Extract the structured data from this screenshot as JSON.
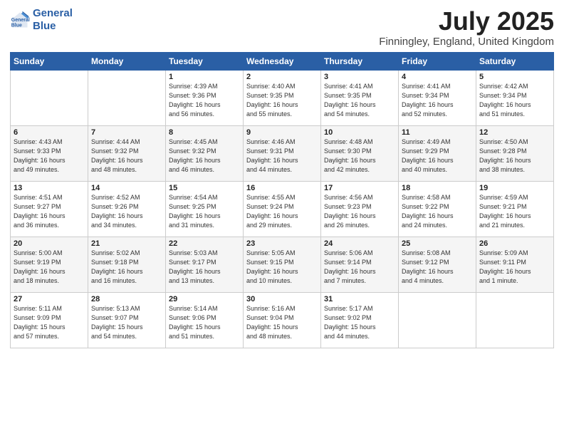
{
  "header": {
    "logo_line1": "General",
    "logo_line2": "Blue",
    "month": "July 2025",
    "location": "Finningley, England, United Kingdom"
  },
  "weekdays": [
    "Sunday",
    "Monday",
    "Tuesday",
    "Wednesday",
    "Thursday",
    "Friday",
    "Saturday"
  ],
  "weeks": [
    [
      {
        "day": "",
        "info": ""
      },
      {
        "day": "",
        "info": ""
      },
      {
        "day": "1",
        "info": "Sunrise: 4:39 AM\nSunset: 9:36 PM\nDaylight: 16 hours\nand 56 minutes."
      },
      {
        "day": "2",
        "info": "Sunrise: 4:40 AM\nSunset: 9:35 PM\nDaylight: 16 hours\nand 55 minutes."
      },
      {
        "day": "3",
        "info": "Sunrise: 4:41 AM\nSunset: 9:35 PM\nDaylight: 16 hours\nand 54 minutes."
      },
      {
        "day": "4",
        "info": "Sunrise: 4:41 AM\nSunset: 9:34 PM\nDaylight: 16 hours\nand 52 minutes."
      },
      {
        "day": "5",
        "info": "Sunrise: 4:42 AM\nSunset: 9:34 PM\nDaylight: 16 hours\nand 51 minutes."
      }
    ],
    [
      {
        "day": "6",
        "info": "Sunrise: 4:43 AM\nSunset: 9:33 PM\nDaylight: 16 hours\nand 49 minutes."
      },
      {
        "day": "7",
        "info": "Sunrise: 4:44 AM\nSunset: 9:32 PM\nDaylight: 16 hours\nand 48 minutes."
      },
      {
        "day": "8",
        "info": "Sunrise: 4:45 AM\nSunset: 9:32 PM\nDaylight: 16 hours\nand 46 minutes."
      },
      {
        "day": "9",
        "info": "Sunrise: 4:46 AM\nSunset: 9:31 PM\nDaylight: 16 hours\nand 44 minutes."
      },
      {
        "day": "10",
        "info": "Sunrise: 4:48 AM\nSunset: 9:30 PM\nDaylight: 16 hours\nand 42 minutes."
      },
      {
        "day": "11",
        "info": "Sunrise: 4:49 AM\nSunset: 9:29 PM\nDaylight: 16 hours\nand 40 minutes."
      },
      {
        "day": "12",
        "info": "Sunrise: 4:50 AM\nSunset: 9:28 PM\nDaylight: 16 hours\nand 38 minutes."
      }
    ],
    [
      {
        "day": "13",
        "info": "Sunrise: 4:51 AM\nSunset: 9:27 PM\nDaylight: 16 hours\nand 36 minutes."
      },
      {
        "day": "14",
        "info": "Sunrise: 4:52 AM\nSunset: 9:26 PM\nDaylight: 16 hours\nand 34 minutes."
      },
      {
        "day": "15",
        "info": "Sunrise: 4:54 AM\nSunset: 9:25 PM\nDaylight: 16 hours\nand 31 minutes."
      },
      {
        "day": "16",
        "info": "Sunrise: 4:55 AM\nSunset: 9:24 PM\nDaylight: 16 hours\nand 29 minutes."
      },
      {
        "day": "17",
        "info": "Sunrise: 4:56 AM\nSunset: 9:23 PM\nDaylight: 16 hours\nand 26 minutes."
      },
      {
        "day": "18",
        "info": "Sunrise: 4:58 AM\nSunset: 9:22 PM\nDaylight: 16 hours\nand 24 minutes."
      },
      {
        "day": "19",
        "info": "Sunrise: 4:59 AM\nSunset: 9:21 PM\nDaylight: 16 hours\nand 21 minutes."
      }
    ],
    [
      {
        "day": "20",
        "info": "Sunrise: 5:00 AM\nSunset: 9:19 PM\nDaylight: 16 hours\nand 18 minutes."
      },
      {
        "day": "21",
        "info": "Sunrise: 5:02 AM\nSunset: 9:18 PM\nDaylight: 16 hours\nand 16 minutes."
      },
      {
        "day": "22",
        "info": "Sunrise: 5:03 AM\nSunset: 9:17 PM\nDaylight: 16 hours\nand 13 minutes."
      },
      {
        "day": "23",
        "info": "Sunrise: 5:05 AM\nSunset: 9:15 PM\nDaylight: 16 hours\nand 10 minutes."
      },
      {
        "day": "24",
        "info": "Sunrise: 5:06 AM\nSunset: 9:14 PM\nDaylight: 16 hours\nand 7 minutes."
      },
      {
        "day": "25",
        "info": "Sunrise: 5:08 AM\nSunset: 9:12 PM\nDaylight: 16 hours\nand 4 minutes."
      },
      {
        "day": "26",
        "info": "Sunrise: 5:09 AM\nSunset: 9:11 PM\nDaylight: 16 hours\nand 1 minute."
      }
    ],
    [
      {
        "day": "27",
        "info": "Sunrise: 5:11 AM\nSunset: 9:09 PM\nDaylight: 15 hours\nand 57 minutes."
      },
      {
        "day": "28",
        "info": "Sunrise: 5:13 AM\nSunset: 9:07 PM\nDaylight: 15 hours\nand 54 minutes."
      },
      {
        "day": "29",
        "info": "Sunrise: 5:14 AM\nSunset: 9:06 PM\nDaylight: 15 hours\nand 51 minutes."
      },
      {
        "day": "30",
        "info": "Sunrise: 5:16 AM\nSunset: 9:04 PM\nDaylight: 15 hours\nand 48 minutes."
      },
      {
        "day": "31",
        "info": "Sunrise: 5:17 AM\nSunset: 9:02 PM\nDaylight: 15 hours\nand 44 minutes."
      },
      {
        "day": "",
        "info": ""
      },
      {
        "day": "",
        "info": ""
      }
    ]
  ]
}
